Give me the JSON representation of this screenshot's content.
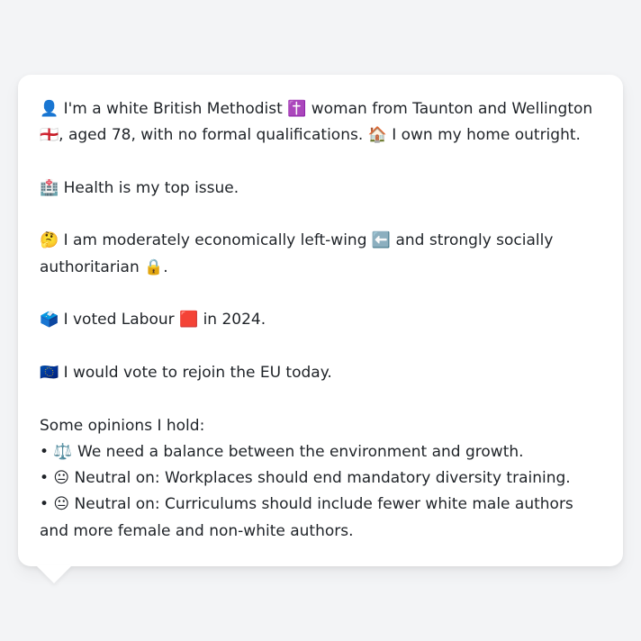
{
  "bio": {
    "identity": "👤 I'm a white British Methodist ✝️ woman from Taunton and Wellington 🏴󠁧󠁢󠁥󠁮󠁧󠁿, aged 78, with no formal qualifications. 🏠 I own my home outright.",
    "top_issue": "🏥 Health is my top issue.",
    "ideology": "🤔 I am moderately economically left-wing ⬅️ and strongly socially authoritarian 🔒.",
    "vote_2024": "🗳️ I voted Labour 🟥 in 2024.",
    "eu": "🇪🇺 I would vote to rejoin the EU today.",
    "opinions_heading": "Some opinions I hold:",
    "opinions": [
      "• ⚖️ We need a balance between the environment and growth.",
      "• 😐 Neutral on: Workplaces should end mandatory diversity training.",
      "• 😐 Neutral on: Curriculums should include fewer white male authors and more female and non-white authors."
    ]
  }
}
